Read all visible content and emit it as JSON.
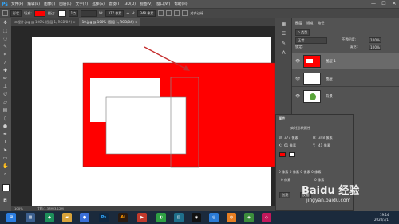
{
  "app": {
    "logo": "Ps",
    "menu": [
      "文件(F)",
      "编辑(E)",
      "图像(I)",
      "图层(L)",
      "文字(Y)",
      "选择(S)",
      "滤镜(T)",
      "3D(D)",
      "视图(V)",
      "窗口(W)",
      "帮助(H)"
    ],
    "window_controls": [
      "—",
      "☐",
      "✕"
    ]
  },
  "options": {
    "mode": "形状",
    "fill_label": "填充:",
    "stroke_label": "描边:",
    "stroke_width": "1点",
    "w_label": "W:",
    "w_value": "377 像素",
    "h_label": "H:",
    "h_value": "348 像素",
    "align_label": "对齐边缘",
    "fill_color": "#ff0000"
  },
  "tabs": [
    {
      "label": "二程片.jpg @ 100% (图层 1, RGB/8#) ×",
      "active": false
    },
    {
      "label": "10.jpg @ 100% (图层 1, RGB/8#) ×",
      "active": true
    }
  ],
  "status": {
    "zoom": "100%",
    "doc": "文档:1.37M/3.12M"
  },
  "layers_panel": {
    "tabs": [
      "图层",
      "通道",
      "路径"
    ],
    "filter": "ρ 类型",
    "blend": "正常",
    "opacity_label": "不透明度:",
    "opacity": "100%",
    "lock_label": "锁定:",
    "fill_label": "填充:",
    "fill": "100%",
    "layers": [
      {
        "name": "图层 1",
        "selected": true
      },
      {
        "name": "图层",
        "selected": false
      },
      {
        "name": "背景",
        "selected": false
      }
    ]
  },
  "properties_panel": {
    "title": "属性",
    "subtitle": "实时形状属性",
    "w_label": "W:",
    "w": "377 像素",
    "h_label": "H:",
    "h": "348 像素",
    "x_label": "X:",
    "x": "61 像素",
    "y_label": "Y:",
    "y": "41 像素",
    "corner_text": "0 像素 0 像素 0 像素 0 像素",
    "corner_a": "0 像素",
    "corner_b": "0 像素",
    "btn": "创建",
    "btn2": "反相"
  },
  "watermark": {
    "brand": "Baidu 经验",
    "url": "jingyan.baidu.com"
  },
  "taskbar": {
    "clock_time": "19:14",
    "clock_date": "2020/3/1"
  },
  "colors": {
    "shape_red": "#ff0000",
    "canvas_white": "#ffffff",
    "arrow_red": "#c62f2f",
    "panel_gray": "#535353"
  }
}
